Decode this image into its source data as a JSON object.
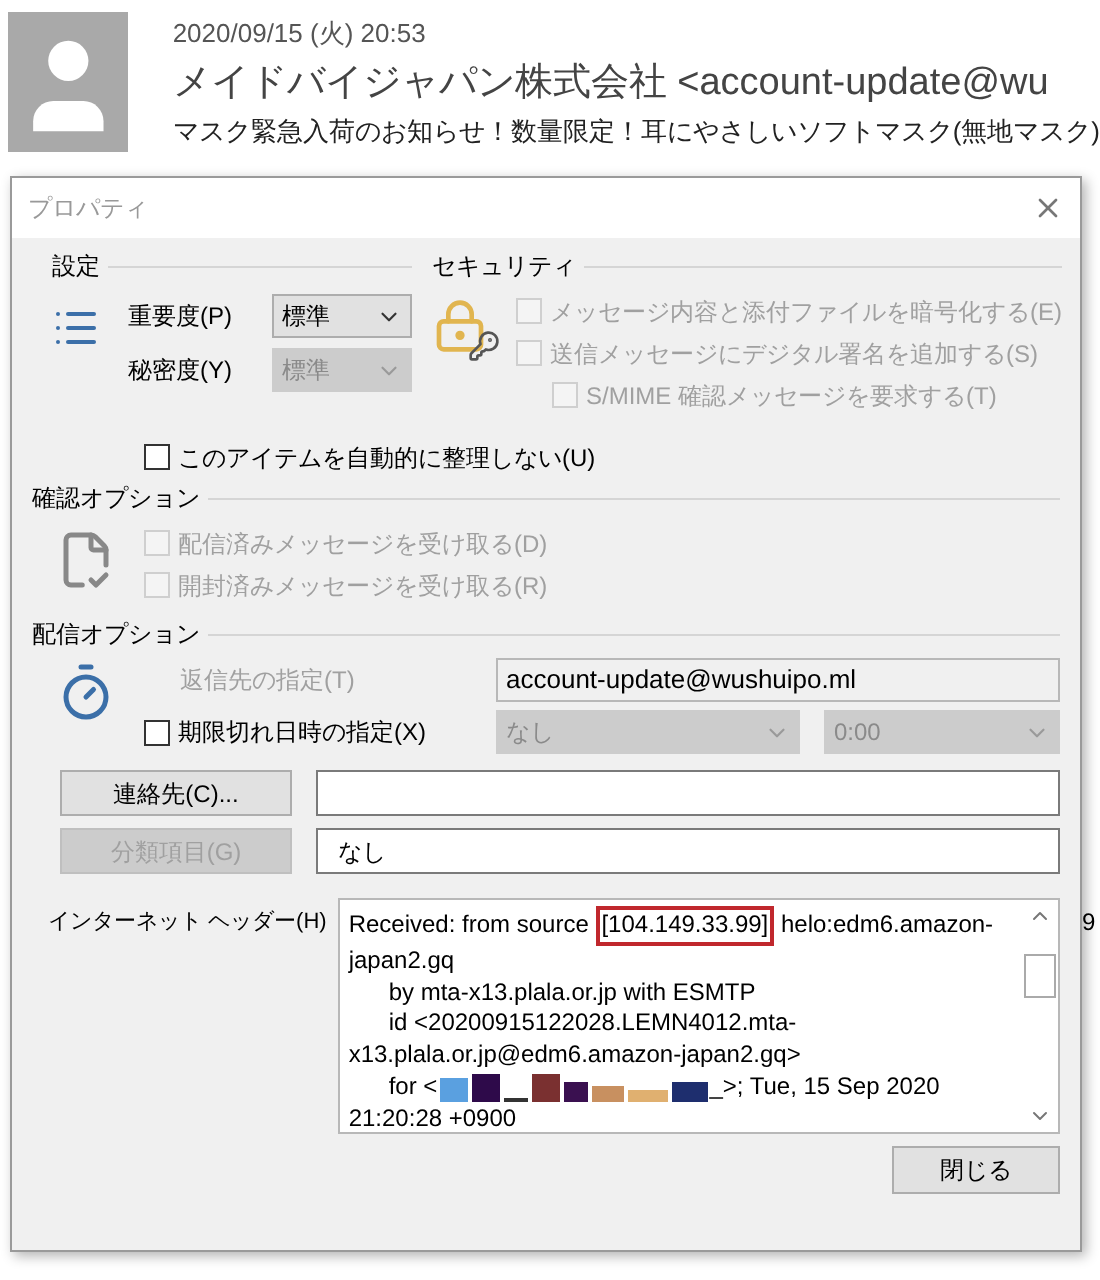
{
  "email": {
    "date": "2020/09/15 (火) 20:53",
    "sender": "メイドバイジャパン株式会社 <account-update@wu",
    "subject": "マスク緊急入荷のお知らせ！数量限定！耳にやさしいソフトマスク(無地マスク)",
    "background_fragments": [
      "9"
    ]
  },
  "dialog": {
    "title": "プロパティ",
    "settings": {
      "heading": "設定",
      "importance": {
        "label": "重要度(P)",
        "value": "標準",
        "disabled": false
      },
      "sensitivity": {
        "label": "秘密度(Y)",
        "value": "標準",
        "disabled": true
      },
      "no_autoarchive": {
        "label": "このアイテムを自動的に整理しない(U)",
        "checked": false,
        "disabled": false
      }
    },
    "security": {
      "heading": "セキュリティ",
      "options": [
        {
          "label": "メッセージ内容と添付ファイルを暗号化する(E)",
          "checked": false,
          "disabled": true
        },
        {
          "label": "送信メッセージにデジタル署名を追加する(S)",
          "checked": false,
          "disabled": true,
          "children": [
            {
              "label": "S/MIME 確認メッセージを要求する(T)",
              "checked": false,
              "disabled": true
            }
          ]
        }
      ]
    },
    "tracking": {
      "heading": "確認オプション",
      "options": [
        {
          "label": "配信済みメッセージを受け取る(D)",
          "checked": false,
          "disabled": true
        },
        {
          "label": "開封済みメッセージを受け取る(R)",
          "checked": false,
          "disabled": true
        }
      ]
    },
    "delivery": {
      "heading": "配信オプション",
      "reply_to": {
        "label": "返信先の指定(T)",
        "value": "account-update@wushuipo.ml",
        "disabled": true
      },
      "expiry": {
        "label": "期限切れ日時の指定(X)",
        "checked": false,
        "date": "なし",
        "time": "0:00",
        "disabled": true
      },
      "contacts": {
        "label": "連絡先(C)...",
        "disabled": false
      },
      "categories": {
        "label": "分類項目(G)",
        "value": "なし",
        "disabled": true
      }
    },
    "internet_headers": {
      "label": "インターネット ヘッダー(H)",
      "lines": [
        [
          {
            "kind": "text",
            "text": "Received: from source "
          },
          {
            "kind": "highlight",
            "text": "[104.149.33.99]"
          },
          {
            "kind": "text",
            "text": " helo:edm6.amazon-"
          }
        ],
        [
          {
            "kind": "text",
            "text": "japan2.gq"
          }
        ],
        [
          {
            "kind": "text",
            "text": "\tby mta-x13.plala.or.jp with ESMTP"
          }
        ],
        [
          {
            "kind": "text",
            "text": "\tid <20200915122028.LEMN4012.mta-"
          }
        ],
        [
          {
            "kind": "text",
            "text": "x13.plala.or.jp@edm6.amazon-japan2.gq>"
          }
        ],
        [
          {
            "kind": "text",
            "text": "\tfor <"
          },
          {
            "kind": "redaction"
          },
          {
            "kind": "text",
            "text": "_>; Tue, 15 Sep 2020"
          }
        ],
        [
          {
            "kind": "text",
            "text": "21:20:28 +0900"
          }
        ]
      ]
    },
    "close_button": "閉じる"
  }
}
